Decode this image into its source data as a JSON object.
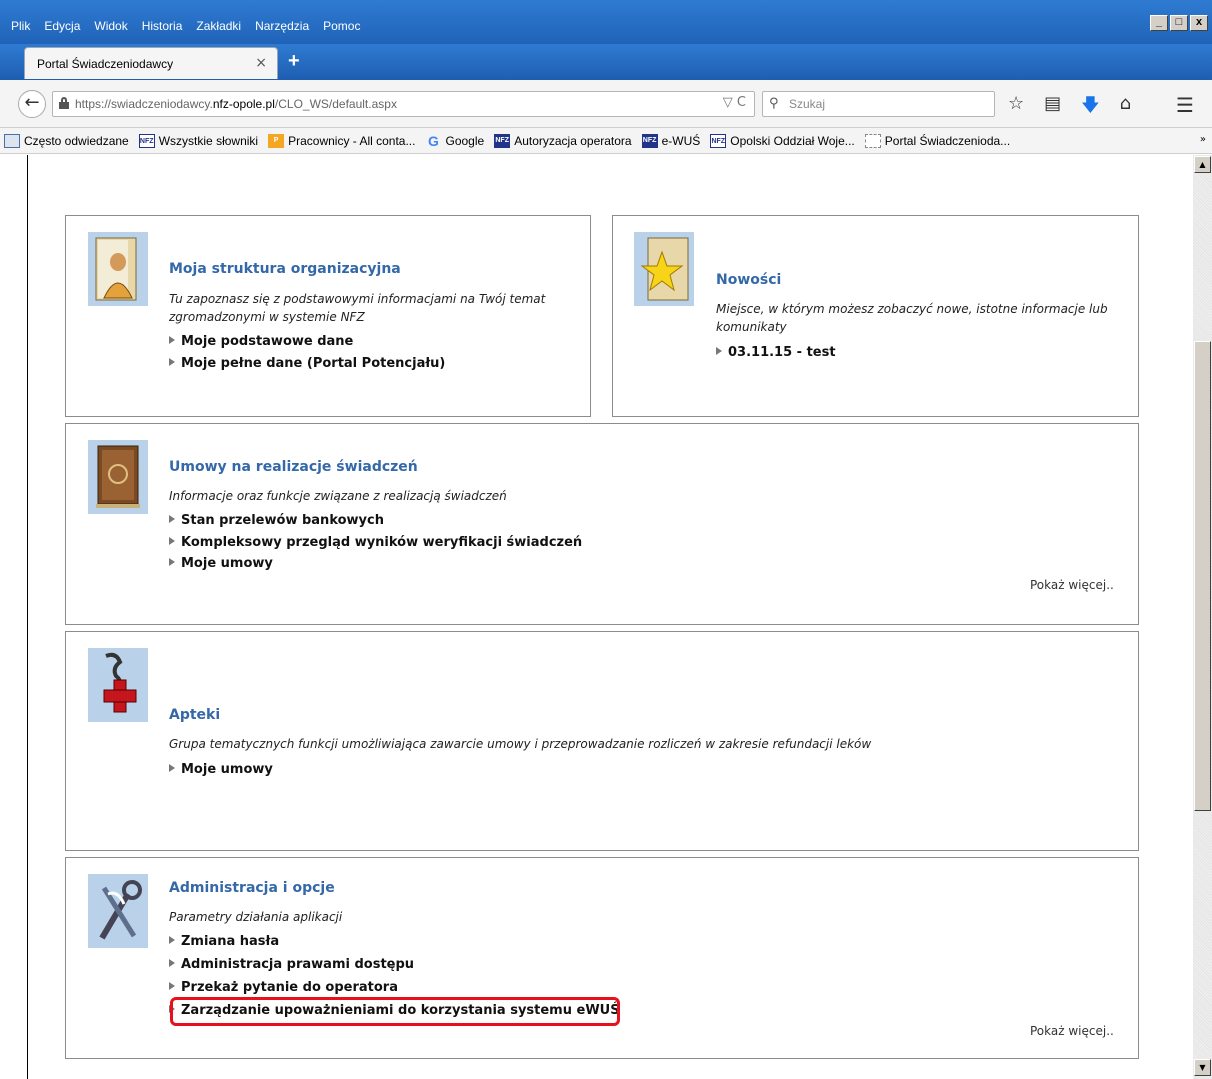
{
  "browser": {
    "menu": [
      "Plik",
      "Edycja",
      "Widok",
      "Historia",
      "Zakładki",
      "Narzędzia",
      "Pomoc"
    ],
    "window_buttons": [
      "_",
      "□",
      "x"
    ],
    "tab": {
      "title": "Portal Świadczeniodawcy",
      "close": "×"
    },
    "new_tab": "+",
    "url": {
      "prefix": "https://swiadczeniodawcy.",
      "domain": "nfz-opole.pl",
      "path": "/CLO_WS/default.aspx",
      "tools": "▽ C"
    },
    "search_placeholder": "Szukaj",
    "bookmarks": [
      {
        "label": "Często odwiedzane",
        "icon": "folder-icon"
      },
      {
        "label": "Wszystkie słowniki",
        "icon": "nfz-icon"
      },
      {
        "label": "Pracownicy - All conta...",
        "icon": "app-icon"
      },
      {
        "label": "Google",
        "icon": "google-icon"
      },
      {
        "label": "Autoryzacja operatora",
        "icon": "nfz-icon"
      },
      {
        "label": "e-WUŚ",
        "icon": "nfz-icon"
      },
      {
        "label": "Opolski Oddział Woje...",
        "icon": "nfz-icon"
      },
      {
        "label": "Portal Świadczenioda...",
        "icon": "page-icon"
      }
    ],
    "bookmarks_more": "»",
    "icons": [
      "back-icon",
      "lock-icon",
      "search-icon",
      "star-icon",
      "reading-list-icon",
      "download-icon",
      "home-icon",
      "menu-icon"
    ]
  },
  "panels": {
    "org": {
      "title": "Moja struktura organizacyjna",
      "desc": "Tu zapoznasz się z podstawowymi informacjami na Twój temat zgromadzonymi w systemie NFZ",
      "links": [
        "Moje podstawowe dane",
        "Moje pełne dane (Portal Potencjału)"
      ]
    },
    "news": {
      "title": "Nowości",
      "desc": "Miejsce, w którym możesz zobaczyć nowe, istotne informacje lub komunikaty",
      "links": [
        "03.11.15 - test"
      ]
    },
    "contracts": {
      "title": "Umowy na realizacje świadczeń",
      "desc": "Informacje oraz funkcje związane z realizacją świadczeń",
      "links": [
        "Stan przelewów bankowych",
        "Kompleksowy przegląd wyników weryfikacji świadczeń",
        "Moje umowy"
      ],
      "more": "Pokaż więcej.."
    },
    "pharmacy": {
      "title": "Apteki",
      "desc": "Grupa tematycznych funkcji umożliwiająca zawarcie umowy i przeprowadzanie rozliczeń w zakresie refundacji leków",
      "links": [
        "Moje umowy"
      ]
    },
    "admin": {
      "title": "Administracja i opcje",
      "desc": "Parametry działania aplikacji",
      "links": [
        "Zmiana hasła",
        "Administracja prawami dostępu",
        "Przekaż pytanie do operatora",
        "Zarządzanie upoważnieniami do korzystania systemu eWUŚ"
      ],
      "more": "Pokaż więcej.."
    }
  },
  "colors": {
    "title_blue": "#3468a8",
    "highlight_red": "#e8101c",
    "chrome_blue": "#2f7bd2"
  }
}
